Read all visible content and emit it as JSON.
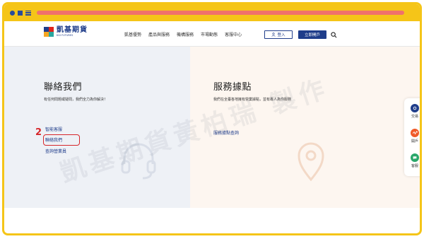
{
  "nav": {
    "logo_cn": "凱基期貨",
    "logo_en": "KGI FUTURES",
    "menu": [
      "凱基優勢",
      "產品與服務",
      "機構服務",
      "市場動態",
      "客服中心"
    ],
    "login_label": "登入",
    "open_account_label": "立即開戶"
  },
  "left": {
    "title": "聯絡我們",
    "description": "有任何問題或疑問，我們全力為你解決！",
    "links": [
      "智能客服",
      "聯絡我們",
      "查詢營業員"
    ]
  },
  "right": {
    "title": "服務據點",
    "description": "我們在全臺各地擁有營業據點，並有專人為你服務",
    "links": [
      "服務據點查詢"
    ]
  },
  "annotation": {
    "step": "2"
  },
  "watermark": "凱基期貨黃柏瑞 製作",
  "side_panel": {
    "items": [
      {
        "label": "交易",
        "color": "#1f3d8a"
      },
      {
        "label": "開戶",
        "color": "#f05a28"
      },
      {
        "label": "客服",
        "color": "#2aa76a"
      }
    ]
  },
  "colors": {
    "frame": "#f5c518",
    "brand": "#1f3d8a",
    "highlight": "#d6262a",
    "url_bar": "#f0716c"
  }
}
